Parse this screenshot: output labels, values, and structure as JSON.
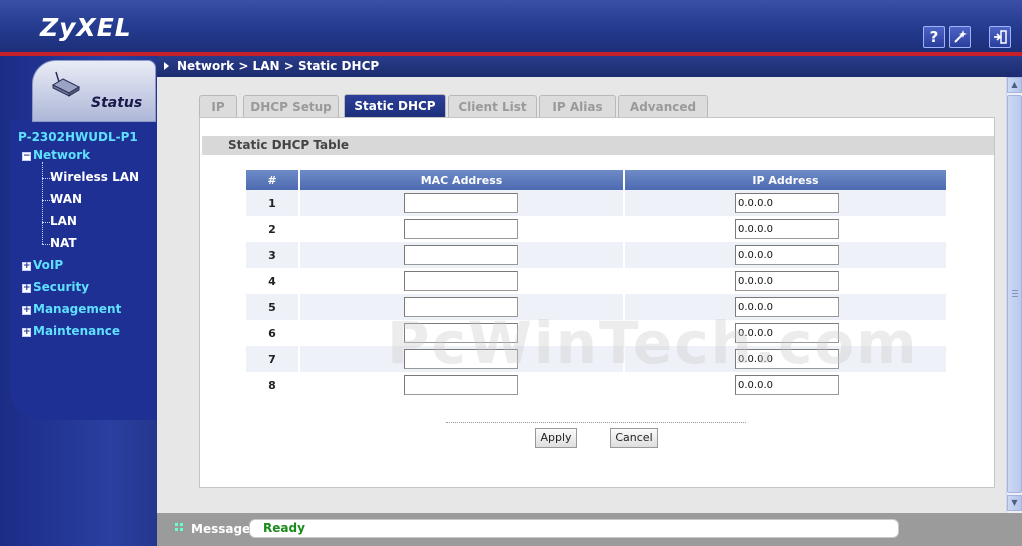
{
  "header": {
    "logo": "ZyXEL",
    "help_icon": "question-mark-icon",
    "wizard_icon": "wizard-wand-icon",
    "logout_icon": "logout-icon"
  },
  "sidebar": {
    "status_label": "Status",
    "device_name": "P-2302HWUDL-P1",
    "items": [
      {
        "label": "Network",
        "expanded": true
      },
      {
        "label": "Wireless LAN"
      },
      {
        "label": "WAN"
      },
      {
        "label": "LAN"
      },
      {
        "label": "NAT"
      },
      {
        "label": "VoIP"
      },
      {
        "label": "Security"
      },
      {
        "label": "Management"
      },
      {
        "label": "Maintenance"
      }
    ]
  },
  "breadcrumb": "Network > LAN > Static DHCP",
  "tabs": [
    {
      "label": "IP"
    },
    {
      "label": "DHCP Setup"
    },
    {
      "label": "Static DHCP",
      "active": true
    },
    {
      "label": "Client List"
    },
    {
      "label": "IP Alias"
    },
    {
      "label": "Advanced"
    }
  ],
  "section_title": "Static DHCP Table",
  "table": {
    "headers": [
      "#",
      "MAC Address",
      "IP Address"
    ],
    "rows": [
      {
        "num": "1",
        "mac": "",
        "ip": "0.0.0.0"
      },
      {
        "num": "2",
        "mac": "",
        "ip": "0.0.0.0"
      },
      {
        "num": "3",
        "mac": "",
        "ip": "0.0.0.0"
      },
      {
        "num": "4",
        "mac": "",
        "ip": "0.0.0.0"
      },
      {
        "num": "5",
        "mac": "",
        "ip": "0.0.0.0"
      },
      {
        "num": "6",
        "mac": "",
        "ip": "0.0.0.0"
      },
      {
        "num": "7",
        "mac": "",
        "ip": "0.0.0.0"
      },
      {
        "num": "8",
        "mac": "",
        "ip": "0.0.0.0"
      }
    ]
  },
  "buttons": {
    "apply": "Apply",
    "cancel": "Cancel"
  },
  "statusbar": {
    "label": "Message",
    "text": "Ready"
  },
  "watermark": "PcWinTech.com",
  "colors": {
    "brand_blue": "#233a8e",
    "accent_red": "#c8202a",
    "nav_cyan": "#5fe0ff",
    "status_green": "#1a8a1a"
  }
}
